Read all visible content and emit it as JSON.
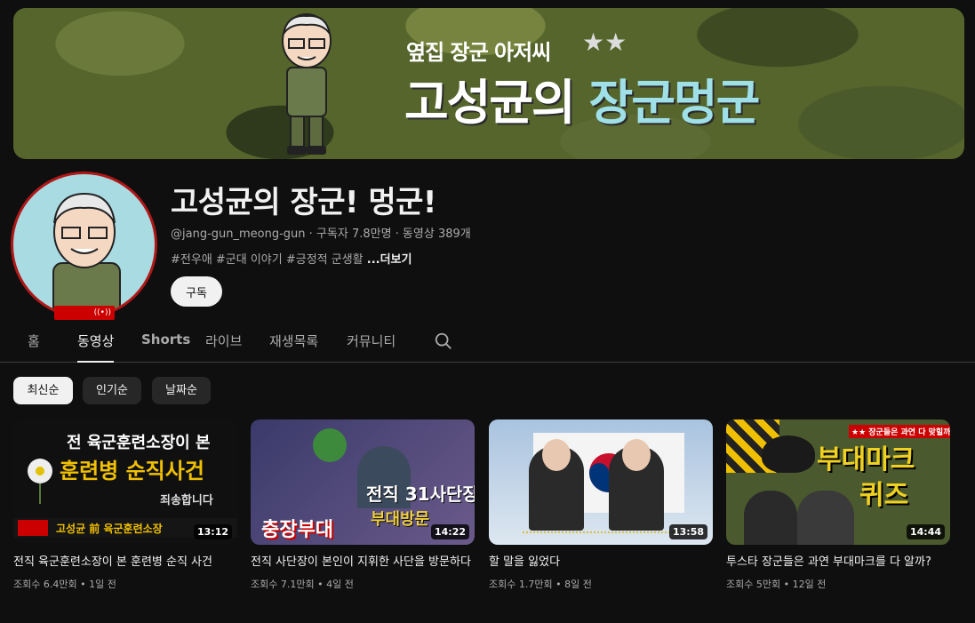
{
  "banner": {
    "subtitle": "옆집 장군 아저씨",
    "title_main": "고성균의 ",
    "title_accent": "장군멍군",
    "stars": "★★"
  },
  "channel": {
    "name": "고성균의 장군! 멍군!",
    "handle": "@jang-gun_meong-gun",
    "meta_rest": " · 구독자 7.8만명 · 동영상 389개",
    "description": "#전우애 #군대 이야기 #긍정적 군생활 ",
    "more": "...더보기",
    "subscribe": "구독",
    "live_badge": "((•))"
  },
  "tabs": [
    "홈",
    "동영상",
    "Shorts",
    "라이브",
    "재생목록",
    "커뮤니티"
  ],
  "filters": [
    "최신순",
    "인기순",
    "날짜순"
  ],
  "videos": [
    {
      "thumb_line1": "전 육군훈련소장이 본",
      "thumb_line2": "훈련병 순직사건",
      "thumb_line3": "죄송합니다",
      "thumb_caption": "고성균 前 육군훈련소장",
      "duration": "13:12",
      "title": "전직 육군훈련소장이 본 훈련병 순직 사건",
      "views": "조회수 6.4만회",
      "age": "1일 전"
    },
    {
      "thumb_line1": "전직 31사단장의",
      "thumb_line2": "부대방문",
      "thumb_line3": "충장부대",
      "duration": "14:22",
      "title": "전직 사단장이 본인이 지휘한 사단을 방문하다",
      "views": "조회수 7.1만회",
      "age": "4일 전"
    },
    {
      "duration": "13:58",
      "title": "할 말을 잃었다",
      "views": "조회수 1.7만회",
      "age": "8일 전"
    },
    {
      "thumb_line1": "부대마크",
      "thumb_line2": "퀴즈",
      "thumb_line3": "★★ 장군들은 과연 다 맞힐까",
      "duration": "14:44",
      "title": "투스타 장군들은 과연 부대마크를 다 알까?",
      "views": "조회수 5만회",
      "age": "12일 전"
    }
  ],
  "colors": {
    "background": "#0f0f0f",
    "accent_red": "#cc0000",
    "banner_accent": "#9fe0e8"
  }
}
